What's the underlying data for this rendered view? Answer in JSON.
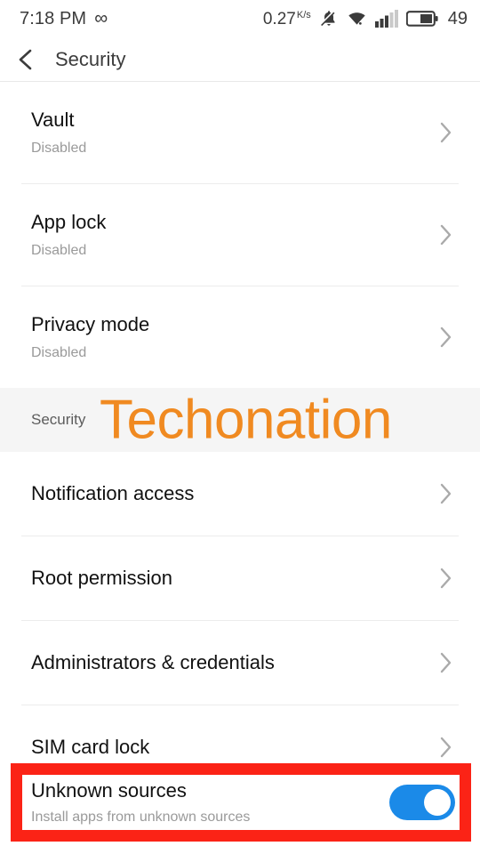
{
  "status_bar": {
    "time": "7:18 PM",
    "infinity_glyph": "∞",
    "net_speed_value": "0.27",
    "net_speed_unit_num": "K",
    "net_speed_unit_den": "s",
    "battery_percent": "49"
  },
  "app_bar": {
    "title": "Security"
  },
  "list": {
    "items": [
      {
        "title": "Vault",
        "subtitle": "Disabled",
        "type": "two-line",
        "chevron": true
      },
      {
        "title": "App lock",
        "subtitle": "Disabled",
        "type": "two-line",
        "chevron": true
      },
      {
        "title": "Privacy mode",
        "subtitle": "Disabled",
        "type": "two-line",
        "chevron": true
      }
    ]
  },
  "section": {
    "label": "Security",
    "watermark": "Techonation",
    "watermark_color": "#f08a21"
  },
  "section_items": [
    {
      "title": "Notification access",
      "chevron": true
    },
    {
      "title": "Root permission",
      "chevron": true
    },
    {
      "title": "Administrators & credentials",
      "chevron": true
    },
    {
      "title": "SIM card lock",
      "chevron": true
    }
  ],
  "unknown_sources": {
    "title": "Unknown sources",
    "subtitle": "Install apps from unknown sources",
    "toggle_state": "on",
    "toggle_color": "#1b8ae8",
    "highlight_color": "#fb2316"
  }
}
